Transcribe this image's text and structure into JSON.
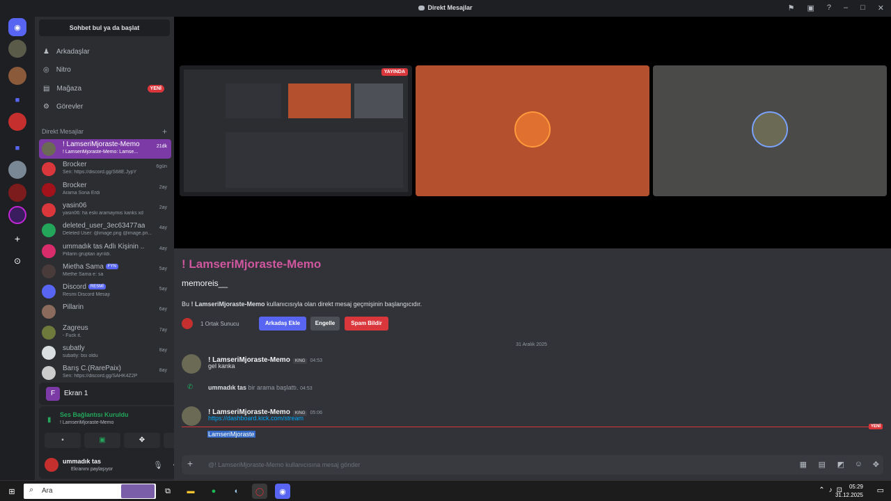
{
  "window": {
    "title": "Direkt Mesajlar"
  },
  "sidebar": {
    "search_label": "Sohbet bul ya da başlat",
    "nav": [
      {
        "label": "Arkadaşlar",
        "icon": "friends-icon"
      },
      {
        "label": "Nitro",
        "icon": "nitro-icon"
      },
      {
        "label": "Mağaza",
        "icon": "shop-icon",
        "badge": "YENİ"
      },
      {
        "label": "Görevler",
        "icon": "quests-icon"
      }
    ],
    "dm_header": "Direkt Mesajlar",
    "dms": [
      {
        "name": "! LamseriMjoraste-Memo",
        "sub": "! LamseriMjoraste-Memo: Lamse...",
        "time": "21dk",
        "color": "#6b6a54",
        "active": true
      },
      {
        "name": "Brocker",
        "sub": "Sen: https://discord.gg/S68E.JypY",
        "time": "6gün",
        "color": "#da373c"
      },
      {
        "name": "Brocker",
        "sub": "Arama Sona Erdi",
        "time": "2ay",
        "color": "#a1121a"
      },
      {
        "name": "yasin06",
        "sub": "yasin06: ha eski aramaymis kanks xd",
        "time": "2ay",
        "color": "#da373c"
      },
      {
        "name": "deleted_user_3ec63477aa...",
        "sub": "Deleted User: @image.png @image.pn...",
        "time": "4ay",
        "color": "#23a55a"
      },
      {
        "name": "ummadık tas Adlı Kişinin ...",
        "sub": "Pillarin gruptan ayrıldı.",
        "time": "4ay",
        "color": "#d82c6b"
      },
      {
        "name": "Mietha Sama",
        "tag": "FYN",
        "sub": "Miethe Sama e: sa",
        "time": "5ay",
        "color": "#4a3b3b"
      },
      {
        "name": "Discord",
        "tag": "RESMİ",
        "sub": "Resmi Discord Mesajı",
        "time": "5ay",
        "color": "#5865f2"
      },
      {
        "name": "Pillarin",
        "sub": "",
        "time": "6ay",
        "color": "#8a6b5c"
      },
      {
        "name": "Zagreus",
        "sub": "- Fuck it.",
        "time": "7ay",
        "color": "#6d7a3c"
      },
      {
        "name": "subatly",
        "sub": "subatly: bsı oldu",
        "time": "8ay",
        "color": "#dbdee1"
      },
      {
        "name": "Barış C.(RarePaix)",
        "sub": "Sen: https://discord.gg/SAHK4Z2P",
        "time": "8ay",
        "color": "#cccccc"
      }
    ],
    "screen": {
      "label": "Ekran 1"
    },
    "voice": {
      "status": "Ses Bağlantısı Kuruldu",
      "channel": "! LamseriMjoraste-Memo"
    },
    "user": {
      "name": "ummadık tas",
      "status": "Ekranını paylaşıyor"
    }
  },
  "stage": {
    "live_badge": "YAYINDA"
  },
  "chat": {
    "title": "! LamseriMjoraste-Memo",
    "username": "memoreis__",
    "intro_prefix": "Bu",
    "intro_name": "! LamseriMjoraste-Memo",
    "intro_suffix": "kullanıcısıyla olan direkt mesaj geçmişinin başlangıcıdır.",
    "mutual": "1 Ortak Sunucu",
    "add_friend": "Arkadaş Ekle",
    "block": "Engelle",
    "report_spam": "Spam Bildir",
    "date": "31 Aralık 2025",
    "messages": [
      {
        "author": "! LamseriMjoraste-Memo",
        "badge": "KING",
        "time": "04:53",
        "text": "gel kanka"
      },
      {
        "author": "! LamseriMjoraste-Memo",
        "badge": "KING",
        "time": "05:06",
        "text": "https://dashboard.kick.com/stream"
      }
    ],
    "call": {
      "user": "ummadık tas",
      "text": "bir arama başlattı.",
      "time": "04:53"
    },
    "new_badge": "YENİ",
    "selected_text": "LamseriMjoraste",
    "input_placeholder": "@! LamseriMjoraste-Memo kullanıcısına mesaj gönder"
  },
  "taskbar": {
    "search": "Ara",
    "time": "05:29",
    "date": "31.12.2025"
  }
}
